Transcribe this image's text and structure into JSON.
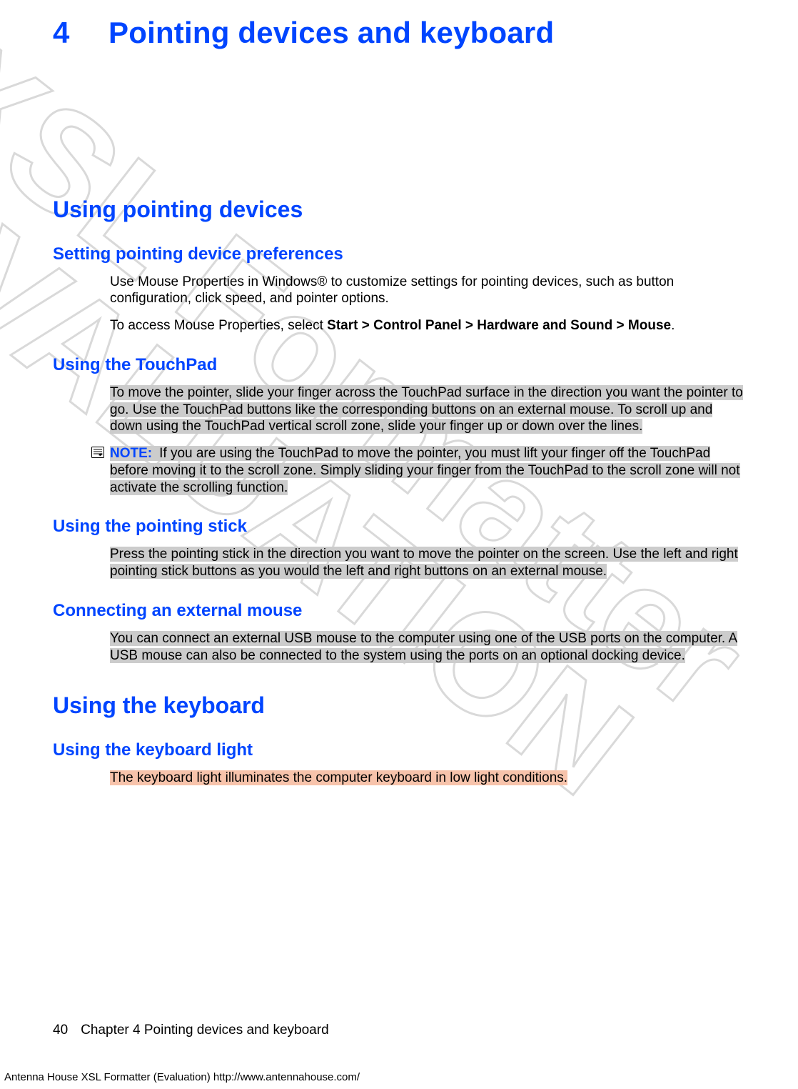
{
  "chapter": {
    "number": "4",
    "title": "Pointing devices and keyboard"
  },
  "sections": {
    "pointing": {
      "heading": "Using pointing devices",
      "prefs": {
        "heading": "Setting pointing device preferences",
        "p1": "Use Mouse Properties in Windows® to customize settings for pointing devices, such as button configuration, click speed, and pointer options.",
        "p2a": "To access Mouse Properties, select ",
        "p2b": "Start > Control Panel > Hardware and Sound > Mouse",
        "p2c": "."
      },
      "touchpad": {
        "heading": "Using the TouchPad",
        "p1": "To move the pointer, slide your finger across the TouchPad surface in the direction you want the pointer to go. Use the TouchPad buttons like the corresponding buttons on an external mouse. To scroll up and down using the TouchPad vertical scroll zone, slide your finger up or down over the lines.",
        "note_label": "NOTE:",
        "note_text": "If you are using the TouchPad to move the pointer, you must lift your finger off the TouchPad before moving it to the scroll zone. Simply sliding your finger from the TouchPad to the scroll zone will not activate the scrolling function."
      },
      "stick": {
        "heading": "Using the pointing stick",
        "p1": "Press the pointing stick in the direction you want to move the pointer on the screen. Use the left and right pointing stick buttons as you would the left and right buttons on an external mouse."
      },
      "mouse": {
        "heading": "Connecting an external mouse",
        "p1": "You can connect an external USB mouse to the computer using one of the USB ports on the computer. A USB mouse can also be connected to the system using the ports on an optional docking device."
      }
    },
    "keyboard": {
      "heading": "Using the keyboard",
      "light": {
        "heading": "Using the keyboard light",
        "p1": "The keyboard light illuminates the computer keyboard in low light conditions."
      }
    }
  },
  "footer": {
    "page": "40",
    "text": "Chapter 4   Pointing devices and keyboard"
  },
  "eval_footer": "Antenna House XSL Formatter (Evaluation)  http://www.antennahouse.com/",
  "watermark": {
    "line1": "XSL Formatter",
    "line2": "EVALUATION"
  }
}
